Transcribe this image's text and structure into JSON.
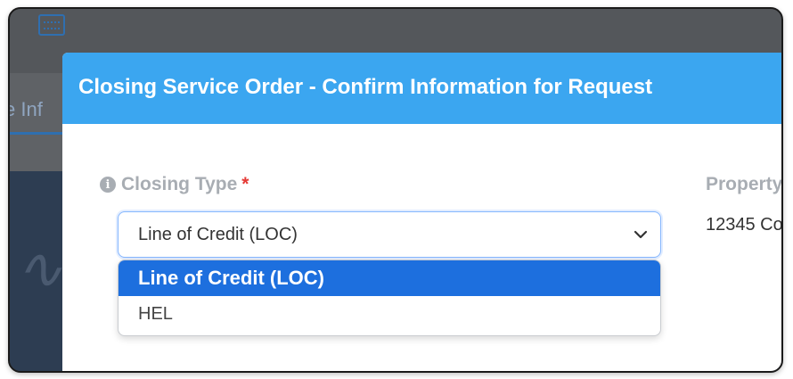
{
  "background": {
    "tab_label": "e Inf"
  },
  "modal": {
    "title": "Closing Service Order - Confirm Information for Request",
    "header_color": "#3ba6f0"
  },
  "closing_type": {
    "label": "Closing Type",
    "required_marker": "*",
    "info_icon": "info-circle-icon",
    "selected_value": "Line of Credit (LOC)",
    "options": [
      {
        "label": "Line of Credit (LOC)",
        "selected": true
      },
      {
        "label": "HEL",
        "selected": false
      }
    ],
    "highlight_color": "#1d6fde"
  },
  "property": {
    "label": "Property",
    "value": "12345 Co"
  }
}
